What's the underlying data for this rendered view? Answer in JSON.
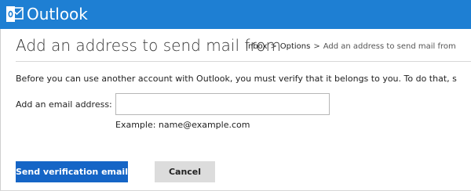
{
  "header": {
    "brand": "Outlook",
    "bg_color": "#1e7fd3",
    "logo_icon": "outlook-envelope-icon"
  },
  "page": {
    "title": "Add an address to send mail from"
  },
  "breadcrumb": {
    "items": [
      "Inbox",
      "Options"
    ],
    "separator": ">",
    "current": "Add an address to send mail from"
  },
  "form": {
    "description": "Before you can use another account with Outlook, you must verify that it belongs to you. To do that, s",
    "email_label": "Add an email address:",
    "email_value": "",
    "email_placeholder": "",
    "example": "Example: name@example.com"
  },
  "buttons": {
    "send_verification": "Send verification email",
    "cancel": "Cancel",
    "primary_color": "#1565c6",
    "secondary_color": "#dcdcdc"
  }
}
